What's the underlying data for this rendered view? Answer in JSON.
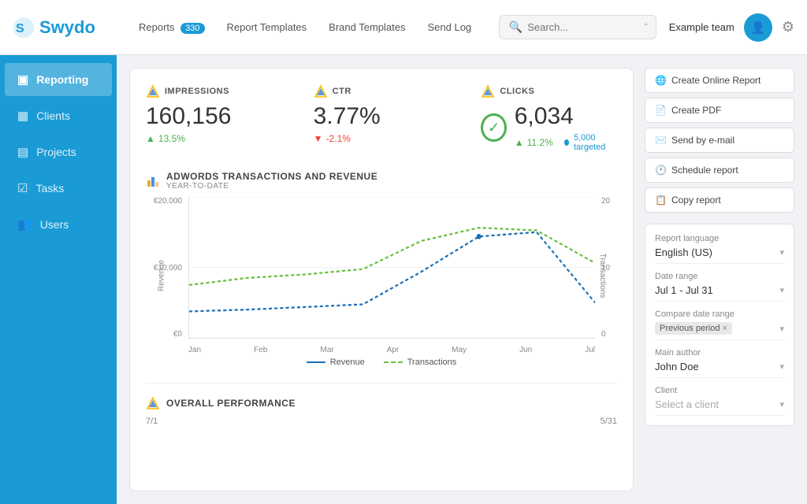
{
  "topbar": {
    "logo": "Swydo",
    "nav": {
      "reports_label": "Reports",
      "reports_badge": "330",
      "report_templates_label": "Report Templates",
      "brand_templates_label": "Brand Templates",
      "send_log_label": "Send Log"
    },
    "search_placeholder": "Search...",
    "team_name": "Example team"
  },
  "sidebar": {
    "items": [
      {
        "id": "reporting",
        "label": "Reporting",
        "icon": "📊",
        "active": true
      },
      {
        "id": "clients",
        "label": "Clients",
        "icon": "👥",
        "active": false
      },
      {
        "id": "projects",
        "label": "Projects",
        "icon": "📁",
        "active": false
      },
      {
        "id": "tasks",
        "label": "Tasks",
        "icon": "✅",
        "active": false
      },
      {
        "id": "users",
        "label": "Users",
        "icon": "👤",
        "active": false
      }
    ]
  },
  "metrics": [
    {
      "id": "impressions",
      "title": "IMPRESSIONS",
      "value": "160,156",
      "change": "13.5%",
      "change_direction": "up",
      "has_check": false
    },
    {
      "id": "ctr",
      "title": "CTR",
      "value": "3.77%",
      "change": "-2.1%",
      "change_direction": "down",
      "has_check": false
    },
    {
      "id": "clicks",
      "title": "CLICKS",
      "value": "6,034",
      "change": "11.2%",
      "change_direction": "up",
      "targeted": "5,000 targeted",
      "has_check": true
    }
  ],
  "chart": {
    "title": "ADWORDS TRANSACTIONS AND REVENUE",
    "subtitle": "YEAR-TO-DATE",
    "y_left_labels": [
      "€20,000",
      "€10,000",
      "€0"
    ],
    "y_right_labels": [
      "20",
      "10",
      "0"
    ],
    "x_labels": [
      "Jan",
      "Feb",
      "Mar",
      "Apr",
      "May",
      "Jun",
      "Jul"
    ],
    "y_axis_left_label": "Revenue",
    "y_axis_right_label": "Transactions",
    "legend": [
      {
        "id": "revenue",
        "label": "Revenue",
        "style": "dashed-blue"
      },
      {
        "id": "transactions",
        "label": "Transactions",
        "style": "dashed-green"
      }
    ]
  },
  "overall_performance": {
    "title": "OVERALL PERFORMANCE",
    "date_left": "7/1",
    "date_right": "5/31"
  },
  "right_panel": {
    "buttons": [
      {
        "id": "create-online",
        "label": "Create Online Report",
        "icon": "🌐"
      },
      {
        "id": "create-pdf",
        "label": "Create PDF",
        "icon": "📄"
      },
      {
        "id": "send-email",
        "label": "Send by e-mail",
        "icon": "✉️"
      },
      {
        "id": "schedule",
        "label": "Schedule report",
        "icon": "🕐"
      },
      {
        "id": "copy",
        "label": "Copy report",
        "icon": "📋"
      }
    ],
    "settings": [
      {
        "id": "language",
        "label": "Report language",
        "value": "English (US)"
      },
      {
        "id": "date-range",
        "label": "Date range",
        "value": "Jul 1 - Jul 31"
      },
      {
        "id": "compare-range",
        "label": "Compare date range",
        "value": "Previous period",
        "has_tag": true
      },
      {
        "id": "author",
        "label": "Main author",
        "value": "John Doe"
      },
      {
        "id": "client",
        "label": "Client",
        "value": "Select a client"
      }
    ]
  }
}
